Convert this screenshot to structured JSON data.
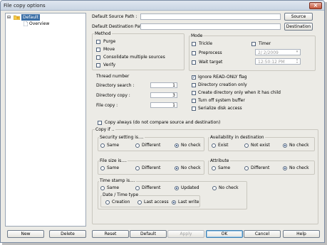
{
  "window": {
    "title": "File copy options",
    "close_glyph": "×"
  },
  "tree": {
    "root": "Default",
    "child": "Overview",
    "root_icon": "folder-icon",
    "child_icon": "document-icon",
    "expander": "⊟"
  },
  "paths": {
    "source_label": "Default Source Path :",
    "dest_label": "Default Destination Path :",
    "source_value": "",
    "dest_value": "",
    "source_button": "Source",
    "dest_button": "Destination"
  },
  "method": {
    "title": "Method",
    "items": [
      {
        "label": "Purge",
        "checked": false
      },
      {
        "label": "Move",
        "checked": false
      },
      {
        "label": "Consolidate multiple sources",
        "checked": false
      },
      {
        "label": "Verify",
        "checked": false
      }
    ]
  },
  "mode": {
    "title": "Mode",
    "trickle": "Trickle",
    "timer": "Timer",
    "preprocess": "Preprocess",
    "wait_target": "Wait target",
    "date_value": "2/ 2/2009",
    "time_value": "12:50:12 PM"
  },
  "thread": {
    "title": "Thread number",
    "rows": [
      {
        "label": "Directory search :",
        "value": "1"
      },
      {
        "label": "Directory copy :",
        "value": "3"
      },
      {
        "label": "File copy :",
        "value": "1"
      }
    ]
  },
  "flags": [
    {
      "label": "Ignore READ-ONLY flag",
      "checked": true
    },
    {
      "label": "Directory creation only",
      "checked": false
    },
    {
      "label": "Create directory only when it has child",
      "checked": false
    },
    {
      "label": "Turn off system buffer",
      "checked": false
    },
    {
      "label": "Serialize disk access",
      "checked": false
    }
  ],
  "copy_always": {
    "label": "Copy always (do not compare source and destination)",
    "checked": false
  },
  "copy_if": {
    "title": "Copy if ..",
    "security": {
      "title": "Security setting is....",
      "options": [
        "Same",
        "Different",
        "No check"
      ],
      "selected": 2
    },
    "availability": {
      "title": "Availability in destination",
      "options": [
        "Exist",
        "Not exist",
        "No check"
      ],
      "selected": 2
    },
    "filesize": {
      "title": "File size is....",
      "options": [
        "Same",
        "Different",
        "No check"
      ],
      "selected": 2
    },
    "attribute": {
      "title": "Attribute",
      "options": [
        "Same",
        "Different",
        "No check"
      ],
      "selected": 2
    },
    "timestamp": {
      "title": "Time stamp is....",
      "options": [
        "Same",
        "Different",
        "Updated",
        "No check"
      ],
      "selected": 2
    },
    "datetime": {
      "title": "Date / Time type",
      "options": [
        "Creation",
        "Last access",
        "Last write"
      ],
      "selected": 2
    }
  },
  "buttons": {
    "new": "New",
    "delete": "Delete",
    "reset": "Reset",
    "default": "Default",
    "apply": "Apply",
    "ok": "OK",
    "cancel": "Cancel",
    "help": "Help"
  }
}
